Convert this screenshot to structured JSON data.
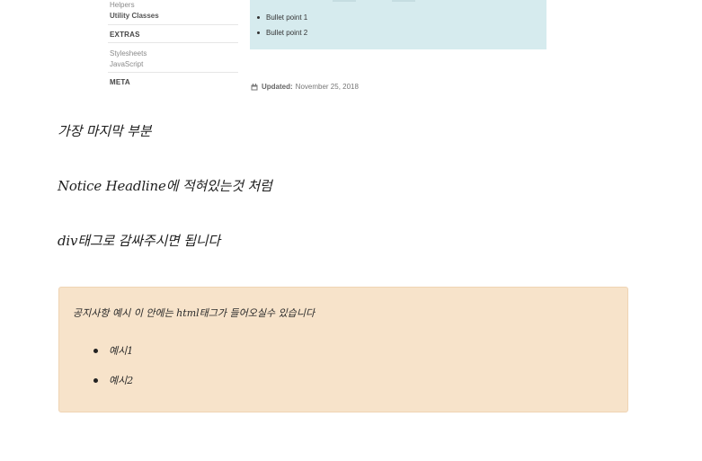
{
  "sidebar": {
    "items": [
      {
        "label": "Helpers",
        "kind": "link"
      },
      {
        "label": "Utility Classes",
        "kind": "link-bold"
      },
      {
        "label": "EXTRAS",
        "kind": "heading"
      },
      {
        "label": "Stylesheets",
        "kind": "link"
      },
      {
        "label": "JavaScript",
        "kind": "link"
      },
      {
        "label": "META",
        "kind": "heading"
      }
    ]
  },
  "preview": {
    "bullets": [
      "Bullet point 1",
      "Bullet point 2"
    ],
    "background_color": "#d6ebee"
  },
  "updated": {
    "label": "Updated:",
    "date": "November 25, 2018",
    "icon": "calendar-icon"
  },
  "content": {
    "paragraphs": [
      "가장 마지막 부분",
      "Notice Headline에 적혀있는것 처럼",
      "div태그로 감싸주시면 됩니다"
    ]
  },
  "notice": {
    "text": "공지사항 예시 이 안에는 html태그가 들어오실수 있습니다",
    "items": [
      "예시1",
      "예시2"
    ],
    "background_color": "#f7e3ca"
  }
}
